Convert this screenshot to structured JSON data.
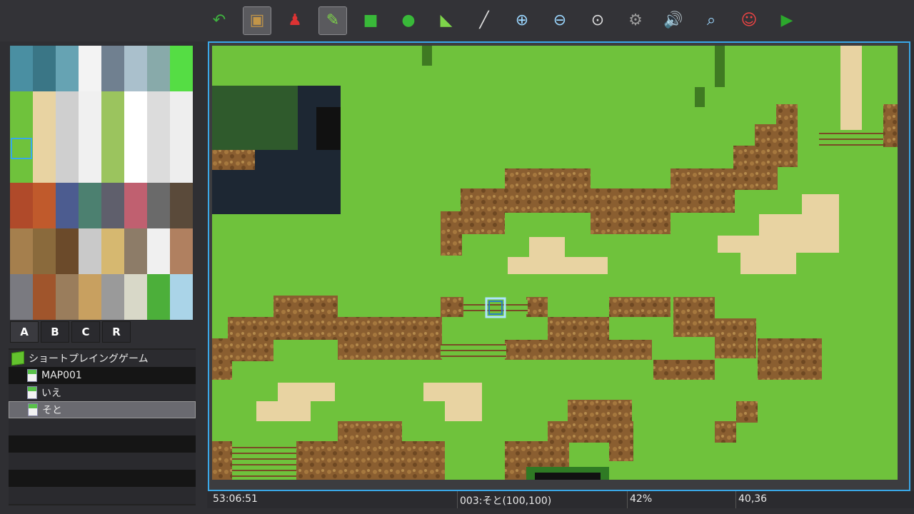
{
  "toolbar": {
    "tools": [
      {
        "name": "undo-icon",
        "glyph": "↶",
        "color": "#3fb43f"
      },
      {
        "name": "map-mode-icon",
        "glyph": "▣",
        "color": "#c29548",
        "active": true
      },
      {
        "name": "event-mode-icon",
        "glyph": "♟",
        "color": "#d33"
      },
      {
        "name": "pencil-icon",
        "glyph": "✎",
        "color": "#7ed54a",
        "active": true
      },
      {
        "name": "rectangle-icon",
        "glyph": "■",
        "color": "#39b939"
      },
      {
        "name": "ellipse-icon",
        "glyph": "●",
        "color": "#39b939"
      },
      {
        "name": "fill-icon",
        "glyph": "◣",
        "color": "#7ed54a"
      },
      {
        "name": "shadow-pen-icon",
        "glyph": "╱",
        "color": "#ddd"
      },
      {
        "name": "zoom-in-icon",
        "glyph": "⊕",
        "color": "#9bd7ff"
      },
      {
        "name": "zoom-out-icon",
        "glyph": "⊖",
        "color": "#9bd7ff"
      },
      {
        "name": "zoom-actual-icon",
        "glyph": "⊙",
        "color": "#ddd"
      },
      {
        "name": "database-icon",
        "glyph": "⚙",
        "color": "#9a9a9a"
      },
      {
        "name": "sound-test-icon",
        "glyph": "🔊",
        "color": "#f0c040"
      },
      {
        "name": "event-search-icon",
        "glyph": "⌕",
        "color": "#9bd7ff"
      },
      {
        "name": "character-generator-icon",
        "glyph": "☺",
        "color": "#e44"
      },
      {
        "name": "playtest-icon",
        "glyph": "▶",
        "color": "#2ca82c"
      }
    ]
  },
  "tileset_tabs": [
    "A",
    "B",
    "C",
    "R"
  ],
  "tree": {
    "project": "ショートプレイングゲーム",
    "maps": [
      "MAP001",
      "いえ",
      "そと"
    ],
    "selected_index": 2
  },
  "status": {
    "time": "53:06:51",
    "map_info": "003:そと(100,100)",
    "zoom": "42%",
    "coords": "40,36"
  }
}
